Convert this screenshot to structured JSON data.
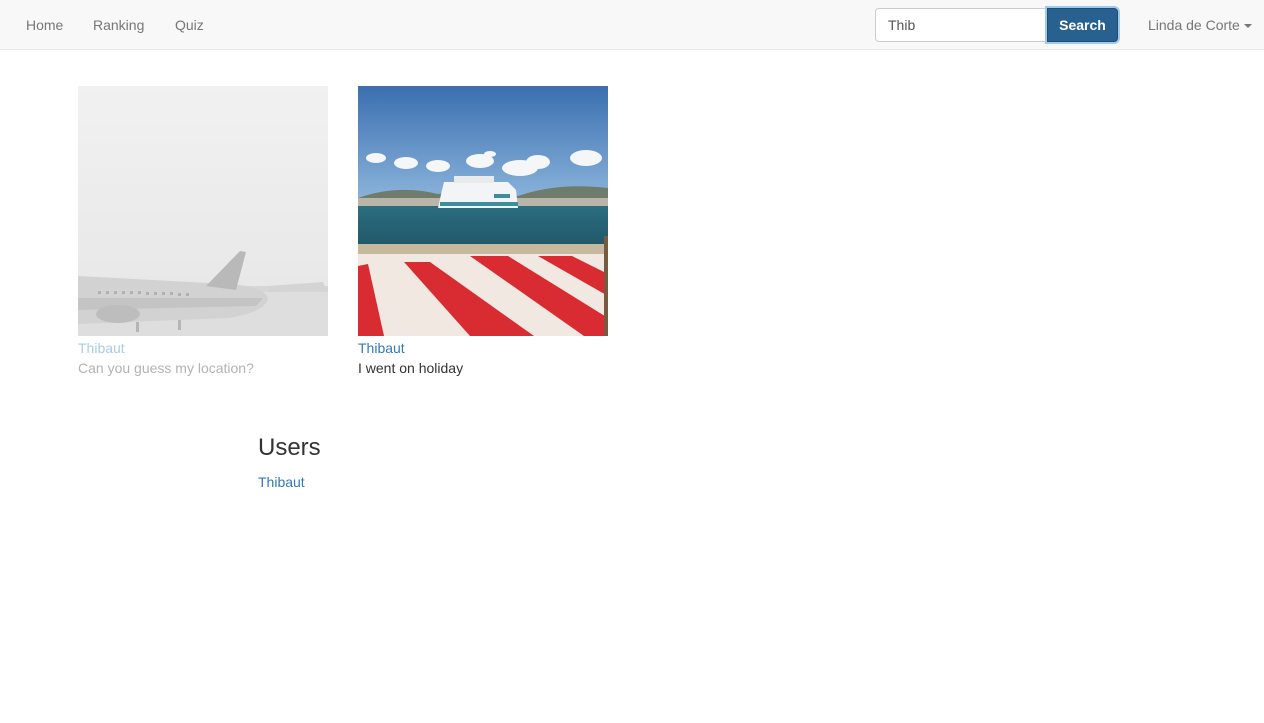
{
  "nav": {
    "items": [
      {
        "label": "Home"
      },
      {
        "label": "Ranking"
      },
      {
        "label": "Quiz"
      }
    ],
    "search": {
      "value": "Thib",
      "button_label": "Search"
    },
    "user_menu": {
      "label": "Linda de Corte"
    }
  },
  "results": {
    "posts": [
      {
        "author": "Thibaut",
        "caption": "Can you guess my location?",
        "faded": true,
        "photo": "airport-airplane-grayscale"
      },
      {
        "author": "Thibaut",
        "caption": "I went on holiday",
        "faded": false,
        "photo": "harbor-ferry-red-white-stripes"
      }
    ],
    "users": {
      "heading": "Users",
      "items": [
        {
          "name": "Thibaut"
        }
      ]
    }
  },
  "colors": {
    "link": "#337ab7",
    "primary_button": "#286090",
    "navbar_bg": "#f8f8f8"
  }
}
